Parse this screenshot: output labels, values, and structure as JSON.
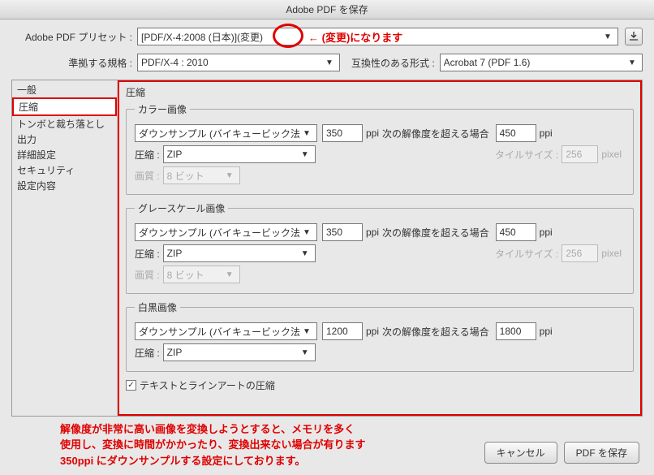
{
  "title": "Adobe PDF を保存",
  "preset": {
    "label": "Adobe PDF プリセット :",
    "value": "[PDF/X-4:2008 (日本)](変更)",
    "annotation": "← (変更)になります"
  },
  "standard": {
    "label": "準拠する規格 :",
    "value": "PDF/X-4 : 2010",
    "compat_label": "互換性のある形式 :",
    "compat_value": "Acrobat 7 (PDF 1.6)"
  },
  "sidebar": {
    "items": [
      "一般",
      "圧縮",
      "トンボと裁ち落とし",
      "出力",
      "詳細設定",
      "セキュリティ",
      "設定内容"
    ],
    "selected": 1
  },
  "panel": {
    "title": "圧縮",
    "groups": [
      {
        "legend": "カラー画像",
        "method": "ダウンサンプル (バイキュービック法)",
        "ppi1": "350",
        "above_label": "次の解像度を超える場合",
        "ppi2": "450",
        "ppi_unit": "ppi",
        "comp_label": "圧縮 :",
        "comp_value": "ZIP",
        "tile_label": "タイルサイズ :",
        "tile_value": "256",
        "tile_unit": "pixel",
        "quality_label": "画質 :",
        "quality_value": "8 ビット",
        "has_quality": true
      },
      {
        "legend": "グレースケール画像",
        "method": "ダウンサンプル (バイキュービック法)",
        "ppi1": "350",
        "above_label": "次の解像度を超える場合",
        "ppi2": "450",
        "ppi_unit": "ppi",
        "comp_label": "圧縮 :",
        "comp_value": "ZIP",
        "tile_label": "タイルサイズ :",
        "tile_value": "256",
        "tile_unit": "pixel",
        "quality_label": "画質 :",
        "quality_value": "8 ビット",
        "has_quality": true
      },
      {
        "legend": "白黒画像",
        "method": "ダウンサンプル (バイキュービック法)",
        "ppi1": "1200",
        "above_label": "次の解像度を超える場合",
        "ppi2": "1800",
        "ppi_unit": "ppi",
        "comp_label": "圧縮 :",
        "comp_value": "ZIP",
        "has_quality": false
      }
    ],
    "checkbox_label": "テキストとラインアートの圧縮",
    "checkbox_checked": true
  },
  "footer": {
    "note_line1": "解像度が非常に高い画像を変換しようとすると、メモリを多く",
    "note_line2": "使用し、変換に時間がかかったり、変換出来ない場合が有ります",
    "note_line3": "350ppi にダウンサンプルする設定にしております。",
    "cancel": "キャンセル",
    "save": "PDF を保存"
  }
}
